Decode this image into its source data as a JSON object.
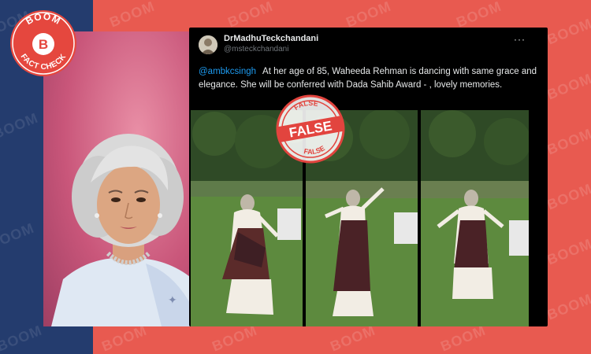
{
  "brand": {
    "logo_top": "BOOM",
    "logo_letter": "B",
    "logo_bottom": "FACT CHECK",
    "watermark": "BOOM",
    "colors": {
      "navy": "#243c6e",
      "coral": "#e85a50",
      "logo_red": "#e5473e"
    }
  },
  "tweet": {
    "display_name": "DrMadhuTeckchandani",
    "handle": "@msteckchandani",
    "more_icon": "···",
    "mention": "@ambkcsingh",
    "text": "At her age of 85, Waheeda Rehman is dancing with same grace and elegance. She will be conferred with Dada Sahib Award - , lovely memories."
  },
  "stamp": {
    "word": "FALSE",
    "color": "#e2443e"
  },
  "icons": [
    "more-icon",
    "false-stamp-icon",
    "boom-logo-icon"
  ]
}
